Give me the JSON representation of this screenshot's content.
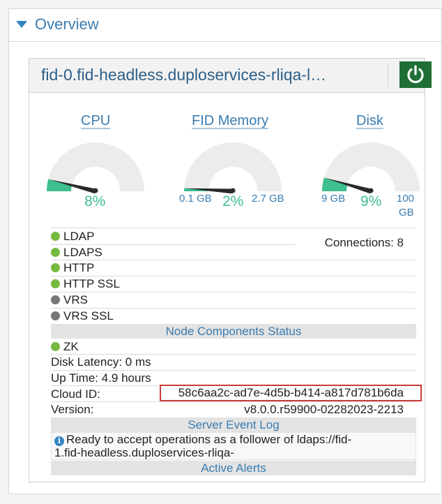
{
  "overview": {
    "title": "Overview"
  },
  "node": {
    "title": "fid-0.fid-headless.duploservices-rliqa-l…"
  },
  "gauges": {
    "cpu": {
      "title": "CPU",
      "percent": "8%"
    },
    "memory": {
      "title": "FID Memory",
      "min": "0.1 GB",
      "percent": "2%",
      "max": "2.7 GB"
    },
    "disk": {
      "title": "Disk",
      "min": "9 GB",
      "percent": "9%",
      "max_line1": "100",
      "max_line2": "GB"
    }
  },
  "gauge_levels": {
    "cpu": 0.08,
    "memory": 0.02,
    "disk": 0.09
  },
  "services": [
    {
      "name": "LDAP",
      "status": "green"
    },
    {
      "name": "LDAPS",
      "status": "green"
    },
    {
      "name": "HTTP",
      "status": "green"
    },
    {
      "name": "HTTP SSL",
      "status": "green"
    },
    {
      "name": "VRS",
      "status": "gray"
    },
    {
      "name": "VRS SSL",
      "status": "gray"
    }
  ],
  "connections": "Connections: 8",
  "sections": {
    "components": "Node Components Status",
    "event_log": "Server Event Log",
    "alerts": "Active Alerts"
  },
  "zk": "ZK",
  "disk_latency": "Disk Latency: 0 ms",
  "uptime": "Up Time: 4.9 hours",
  "cloud_id": {
    "label": "Cloud ID:",
    "value": "58c6aa2c-ad7e-4d5b-b414-a817d781b6da"
  },
  "version": {
    "label": "Version:",
    "value": "v8.0.0.r59900-02282023-2213"
  },
  "event_log": {
    "line1": "Ready to accept operations as a follower of ldaps://fid-",
    "line2": "1.fid-headless.duploservices-rliqa-"
  },
  "colors": {
    "accent": "#3a7cb0",
    "gauge_fill": "#3fbf8e",
    "status_green": "#77b843",
    "status_gray": "#777777",
    "power_green": "#1f6f35",
    "highlight_red": "#cc3a3a"
  }
}
